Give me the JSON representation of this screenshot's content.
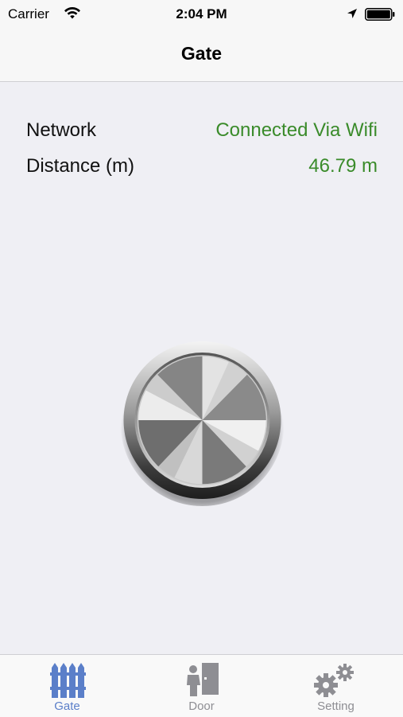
{
  "status_bar": {
    "carrier": "Carrier",
    "time": "2:04 PM",
    "icons": [
      "wifi-icon",
      "location-arrow-icon",
      "battery-icon"
    ]
  },
  "nav": {
    "title": "Gate"
  },
  "info": {
    "network_label": "Network",
    "network_value": "Connected Via Wifi",
    "distance_label": "Distance (m)",
    "distance_value": "46.79 m"
  },
  "gate_button": {
    "icon": "metal-push-button"
  },
  "tabs": [
    {
      "label": "Gate",
      "icon": "fence-icon",
      "selected": true
    },
    {
      "label": "Door",
      "icon": "person-door-icon",
      "selected": false
    },
    {
      "label": "Setting",
      "icon": "gears-icon",
      "selected": false
    }
  ],
  "colors": {
    "value_green": "#3a8b2a",
    "tab_selected": "#5b7fc9",
    "tab_unselected": "#8e8e93",
    "background": "#efeff4"
  }
}
